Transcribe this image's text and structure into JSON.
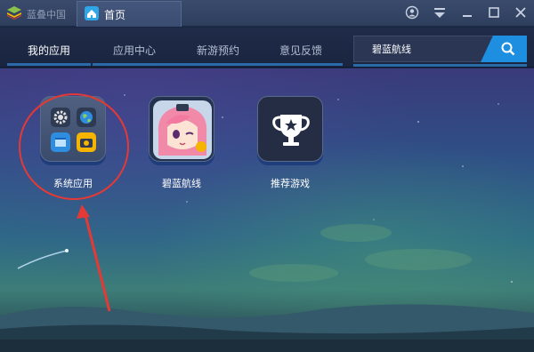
{
  "titlebar": {
    "brand": "蓝叠中国",
    "home_tab": "首页",
    "controls": [
      "user-icon",
      "menu-icon",
      "minimize-icon",
      "maximize-icon",
      "close-icon"
    ]
  },
  "nav": {
    "tabs": [
      {
        "label": "我的应用",
        "active": true
      },
      {
        "label": "应用中心",
        "active": false
      },
      {
        "label": "新游预约",
        "active": false
      },
      {
        "label": "意见反馈",
        "active": false
      }
    ],
    "search_value": "碧蓝航线",
    "search_icon": "search-icon"
  },
  "apps": [
    {
      "label": "系统应用",
      "icon": "system-apps-icon"
    },
    {
      "label": "碧蓝航线",
      "icon": "azur-lane-icon"
    },
    {
      "label": "推荐游戏",
      "icon": "trophy-icon"
    }
  ],
  "colors": {
    "accent": "#1e8fe0",
    "titlebar": "#3a4b6c",
    "annotation": "#e53935"
  }
}
